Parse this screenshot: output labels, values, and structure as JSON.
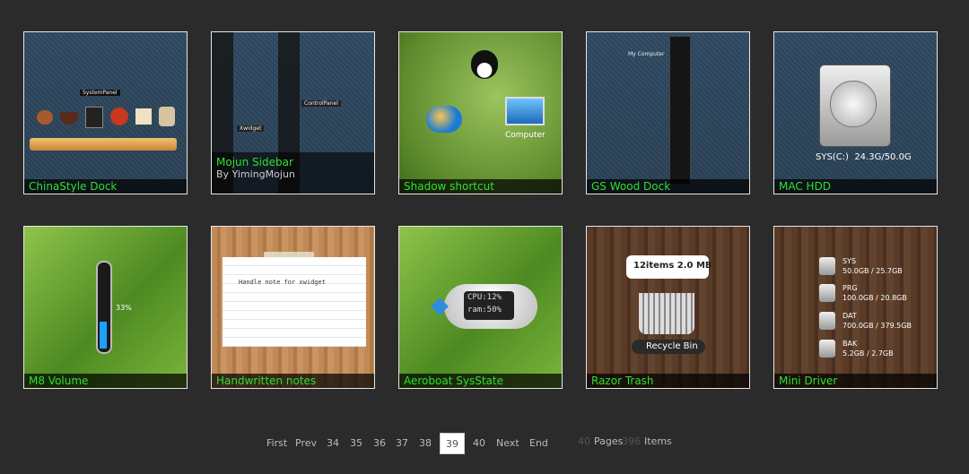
{
  "items": [
    {
      "label": "ChinaStyle Dock",
      "dock_caption": "SystemPanel"
    },
    {
      "label": "Mojun Sidebar",
      "subtitle": "By YimingMojun",
      "w1": "Xwidget",
      "w2": "ControlPanel"
    },
    {
      "label": "Shadow shortcut",
      "caption": "Computer"
    },
    {
      "label": "GS Wood Dock",
      "caption": "My Computer"
    },
    {
      "label": "MAC HDD",
      "caption": "SYS(C:)  24.3G/50.0G"
    },
    {
      "label": "M8 Volume",
      "percent": "33%"
    },
    {
      "label": "Handwritten notes",
      "note": "Handle note for xwidget"
    },
    {
      "label": "Aeroboat SysState",
      "cpu": "CPU:12%",
      "ram": "ram:50%"
    },
    {
      "label": "Razor Trash",
      "bubble": "12items 2.0 MB",
      "caption": "Recycle Bin"
    },
    {
      "label": "Mini Driver",
      "drives": [
        {
          "name": "SYS",
          "size": "50.0GB / 25.7GB"
        },
        {
          "name": "PRG",
          "size": "100.0GB / 20.8GB"
        },
        {
          "name": "DAT",
          "size": "700.0GB / 379.5GB"
        },
        {
          "name": "BAK",
          "size": "5.2GB / 2.7GB"
        }
      ]
    }
  ],
  "pagination": {
    "first": "First",
    "prev": "Prev",
    "pages": [
      "34",
      "35",
      "36",
      "37",
      "38"
    ],
    "current": "39",
    "after": "40",
    "next": "Next",
    "end": "End",
    "total_pages": "40",
    "pages_label": "Pages",
    "total_items": "396",
    "items_label": "Items"
  }
}
